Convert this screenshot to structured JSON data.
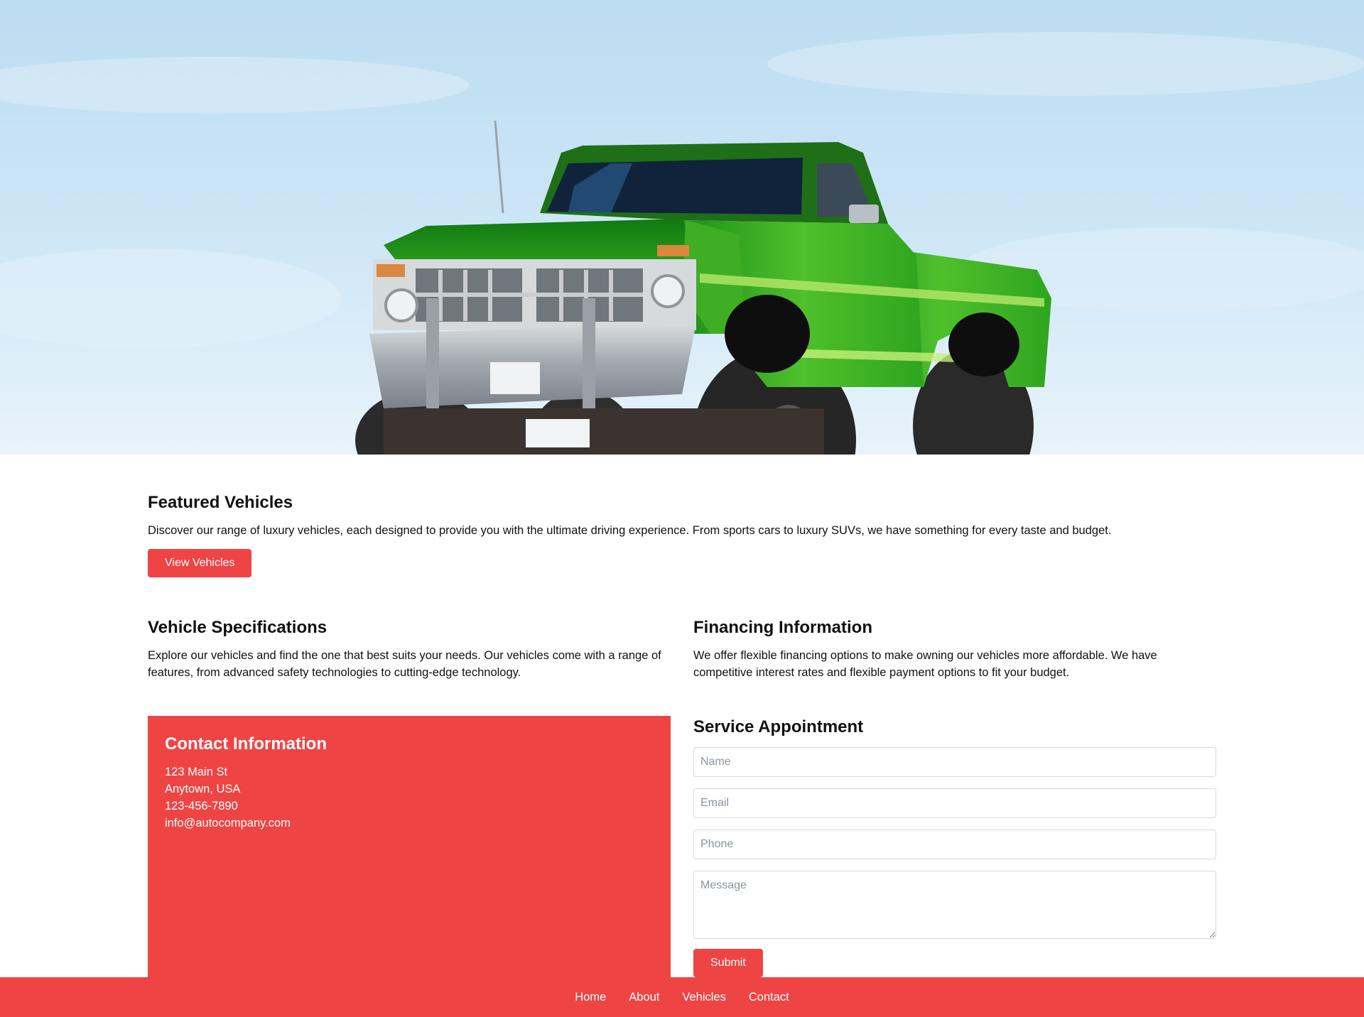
{
  "colors": {
    "accent": "#ef4444",
    "text": "#111111",
    "background": "#ffffff",
    "placeholder": "#8b93a0"
  },
  "hero": {
    "image": "green-monster-truck-photo"
  },
  "featured": {
    "title": "Featured Vehicles",
    "description": "Discover our range of luxury vehicles, each designed to provide you with the ultimate driving experience. From sports cars to luxury SUVs, we have something for every taste and budget.",
    "button_label": "View Vehicles"
  },
  "specs": {
    "title": "Vehicle Specifications",
    "description": "Explore our vehicles and find the one that best suits your needs. Our vehicles come with a range of features, from advanced safety technologies to cutting-edge technology."
  },
  "financing": {
    "title": "Financing Information",
    "description": "We offer flexible financing options to make owning our vehicles more affordable. We have competitive interest rates and flexible payment options to fit your budget."
  },
  "contact": {
    "title": "Contact Information",
    "address_line1": "123 Main St",
    "address_line2": "Anytown, USA",
    "phone": "123-456-7890",
    "email": "info@autocompany.com"
  },
  "service": {
    "title": "Service Appointment",
    "name_placeholder": "Name",
    "email_placeholder": "Email",
    "phone_placeholder": "Phone",
    "message_placeholder": "Message",
    "submit_label": "Submit"
  },
  "footer": {
    "links": [
      {
        "label": "Home"
      },
      {
        "label": "About"
      },
      {
        "label": "Vehicles"
      },
      {
        "label": "Contact"
      }
    ]
  }
}
